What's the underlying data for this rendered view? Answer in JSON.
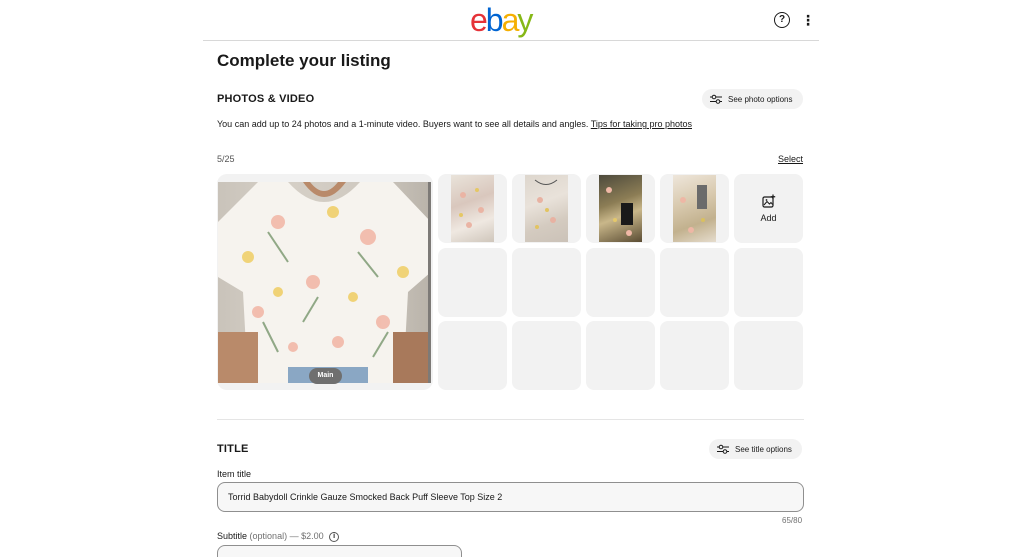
{
  "header": {
    "logo": {
      "e": "e",
      "b": "b",
      "a": "a",
      "y": "y"
    },
    "help_icon": "?",
    "more_icon": "⋮"
  },
  "page": {
    "title": "Complete your listing"
  },
  "photos": {
    "heading": "PHOTOS & VIDEO",
    "options_label": "See photo options",
    "info_text": "You can add up to 24 photos and a 1-minute video. Buyers want to see all details and angles. ",
    "tips_link": "Tips for taking pro photos",
    "count": "5/25",
    "select_label": "Select",
    "main_badge": "Main",
    "add_label": "Add"
  },
  "title_section": {
    "heading": "TITLE",
    "options_label": "See title options",
    "item_title_label": "Item title",
    "item_title_value": "Torrid Babydoll Crinkle Gauze Smocked Back Puff Sleeve Top Size 2",
    "char_count": "65/80",
    "subtitle_label": "Subtitle",
    "subtitle_optional": "(optional)",
    "subtitle_price": " — $2.00",
    "info_icon": "i"
  },
  "colors": {
    "logo_e": "#e53238",
    "logo_b": "#0064d2",
    "logo_a": "#f5af02",
    "logo_y": "#86b817",
    "tile_bg": "#f2f2f2"
  }
}
